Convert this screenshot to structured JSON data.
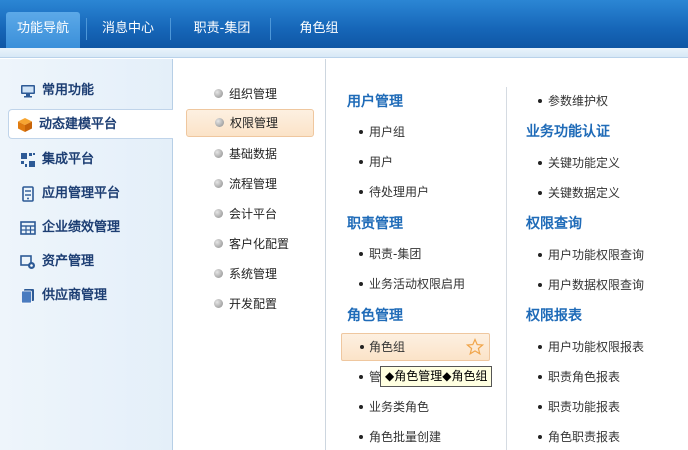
{
  "tabs": [
    {
      "label": "功能导航",
      "active": true
    },
    {
      "label": "消息中心",
      "active": false
    },
    {
      "label": "职责-集团",
      "active": false
    },
    {
      "label": "角色组",
      "active": false
    }
  ],
  "sidebar": {
    "items": [
      {
        "label": "常用功能",
        "icon": "monitor-icon",
        "active": false
      },
      {
        "label": "动态建模平台",
        "icon": "cube-icon",
        "active": true
      },
      {
        "label": "集成平台",
        "icon": "grid-icon",
        "active": false
      },
      {
        "label": "应用管理平台",
        "icon": "server-icon",
        "active": false
      },
      {
        "label": "企业绩效管理",
        "icon": "table-icon",
        "active": false
      },
      {
        "label": "资产管理",
        "icon": "asset-icon",
        "active": false
      },
      {
        "label": "供应商管理",
        "icon": "supplier-icon",
        "active": false
      }
    ]
  },
  "middle": {
    "items": [
      {
        "label": "组织管理",
        "active": false
      },
      {
        "label": "权限管理",
        "active": true
      },
      {
        "label": "基础数据",
        "active": false
      },
      {
        "label": "流程管理",
        "active": false
      },
      {
        "label": "会计平台",
        "active": false
      },
      {
        "label": "客户化配置",
        "active": false
      },
      {
        "label": "系统管理",
        "active": false
      },
      {
        "label": "开发配置",
        "active": false
      }
    ]
  },
  "panel": {
    "col1": {
      "user_mgmt": {
        "title": "用户管理",
        "links": [
          "用户组",
          "用户",
          "待处理用户"
        ]
      },
      "duty_mgmt": {
        "title": "职责管理",
        "links": [
          "职责-集团",
          "业务活动权限启用"
        ]
      },
      "role_mgmt": {
        "title": "角色管理",
        "links": [
          "角色组",
          "管",
          "业务类角色",
          "角色批量创建"
        ]
      }
    },
    "col2": {
      "top_link": "参数维护权",
      "biz_auth": {
        "title": "业务功能认证",
        "links": [
          "关键功能定义",
          "关键数据定义"
        ]
      },
      "perm_query": {
        "title": "权限查询",
        "links": [
          "用户功能权限查询",
          "用户数据权限查询"
        ]
      },
      "perm_report": {
        "title": "权限报表",
        "links": [
          "用户功能权限报表",
          "职责角色报表",
          "职责功能报表",
          "角色职责报表"
        ]
      }
    }
  },
  "tooltip": "◆角色管理◆角色组",
  "colors": {
    "topbar": "#1666b8",
    "active_tab": "#3a8fd9",
    "section_title": "#1f6bb8",
    "sidebar_text": "#1d3e73",
    "highlight": "#fbe3c8",
    "highlight_border": "#efc79f"
  }
}
